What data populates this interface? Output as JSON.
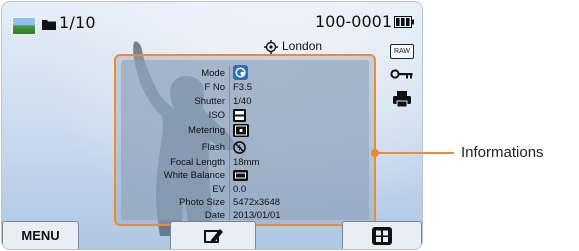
{
  "status": {
    "image_counter": "1/10",
    "file_number": "100-0001",
    "location": "London"
  },
  "icons": {
    "thumbnail": "thumbnail-icon",
    "folder": "folder-icon",
    "battery": "battery-icon",
    "gps": "gps-target-icon",
    "raw": "RAW",
    "protect": "key-icon",
    "print": "printer-icon",
    "mode": "smart-mode-icon",
    "iso": "iso-auto-icon",
    "metering": "metering-icon",
    "flash": "flash-off-icon",
    "white_balance": "wb-auto-icon",
    "edit": "edit-icon",
    "view": "grid-view-icon"
  },
  "info": {
    "labels": {
      "mode": "Mode",
      "fno": "F No",
      "shutter": "Shutter",
      "iso": "ISO",
      "metering": "Metering",
      "flash": "Flash",
      "focal": "Focal Length",
      "wb": "White Balance",
      "ev": "EV",
      "size": "Photo Size",
      "date": "Date"
    },
    "values": {
      "fno": "F3.5",
      "shutter": "1/40",
      "focal": "18mm",
      "ev": "0.0",
      "size": "5472x3648",
      "date": "2013/01/01"
    }
  },
  "buttons": {
    "menu": "MENU"
  },
  "callout": {
    "label": "Informations"
  },
  "colors": {
    "accent": "#f08a31"
  }
}
